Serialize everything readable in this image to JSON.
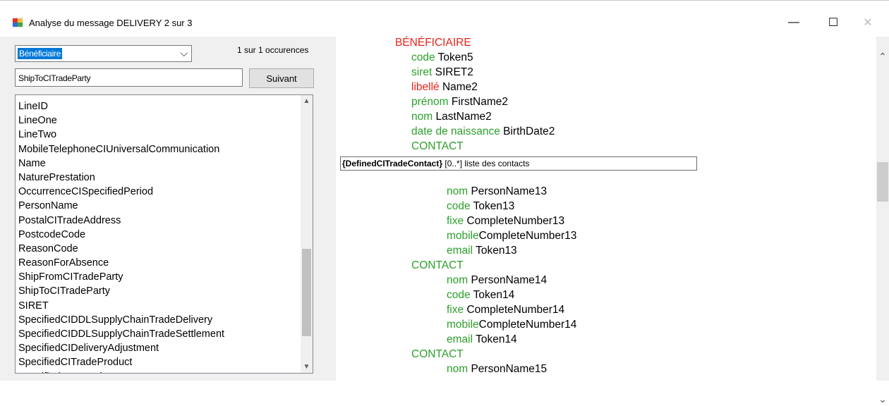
{
  "window": {
    "title": "Analyse du message DELIVERY  2 sur  3",
    "icon": "app-window-icon",
    "minimize_glyph": "—",
    "maximize_glyph": "☐",
    "close_glyph": "✕"
  },
  "search": {
    "combo_value": "Bénéficiaire",
    "occurrences": "1 sur  1 occurences",
    "text_value": "ShipToCITradeParty",
    "next_button": "Suivant"
  },
  "list": {
    "items": [
      "LineID",
      "LineOne",
      "LineTwo",
      "MobileTelephoneCIUniversalCommunication",
      "Name",
      "NaturePrestation",
      "OccurrenceCISpecifiedPeriod",
      "PersonName",
      "PostalCITradeAddress",
      "PostcodeCode",
      "ReasonCode",
      "ReasonForAbsence",
      "ShipFromCITradeParty",
      "ShipToCITradeParty",
      "SIRET",
      "SpecifiedCIDDLSupplyChainTradeDelivery",
      "SpecifiedCIDDLSupplyChainTradeSettlement",
      "SpecifiedCIDeliveryAdjustment",
      "SpecifiedCITradeProduct",
      "SpecifiedTransactionID"
    ]
  },
  "tree": {
    "section": "BÉNÉFICIAIRE",
    "fields": [
      {
        "key": "code",
        "value": "Token5"
      },
      {
        "key": "siret",
        "value": "SIRET2"
      },
      {
        "key": "libellé",
        "value": "Name2"
      },
      {
        "key": "prénom",
        "value": "FirstName2"
      },
      {
        "key": "nom",
        "value": "LastName2"
      },
      {
        "key": "date de naissance",
        "value": "BirthDate2"
      }
    ],
    "contact_label": "CONTACT",
    "tooltip_bold": "{DefinedCITradeContact}",
    "tooltip_rest": " [0..*] liste des contacts",
    "contact1": [
      {
        "key": "nom",
        "value": "PersonName13"
      },
      {
        "key": "code",
        "value": "Token13"
      },
      {
        "key": "fixe",
        "value": "CompleteNumber13"
      },
      {
        "key": "mobile",
        "value": "CompleteNumber13"
      },
      {
        "key": "email",
        "value": "Token13"
      }
    ],
    "contact2": [
      {
        "key": "nom",
        "value": "PersonName14"
      },
      {
        "key": "code",
        "value": "Token14"
      },
      {
        "key": "fixe",
        "value": "CompleteNumber14"
      },
      {
        "key": "mobile",
        "value": "CompleteNumber14"
      },
      {
        "key": "email",
        "value": "Token14"
      }
    ],
    "contact3": [
      {
        "key": "nom",
        "value": "PersonName15"
      }
    ]
  },
  "colors": {
    "key_green": "#2ca02c",
    "key_red": "#e8231b",
    "selection_blue": "#0078d7"
  }
}
